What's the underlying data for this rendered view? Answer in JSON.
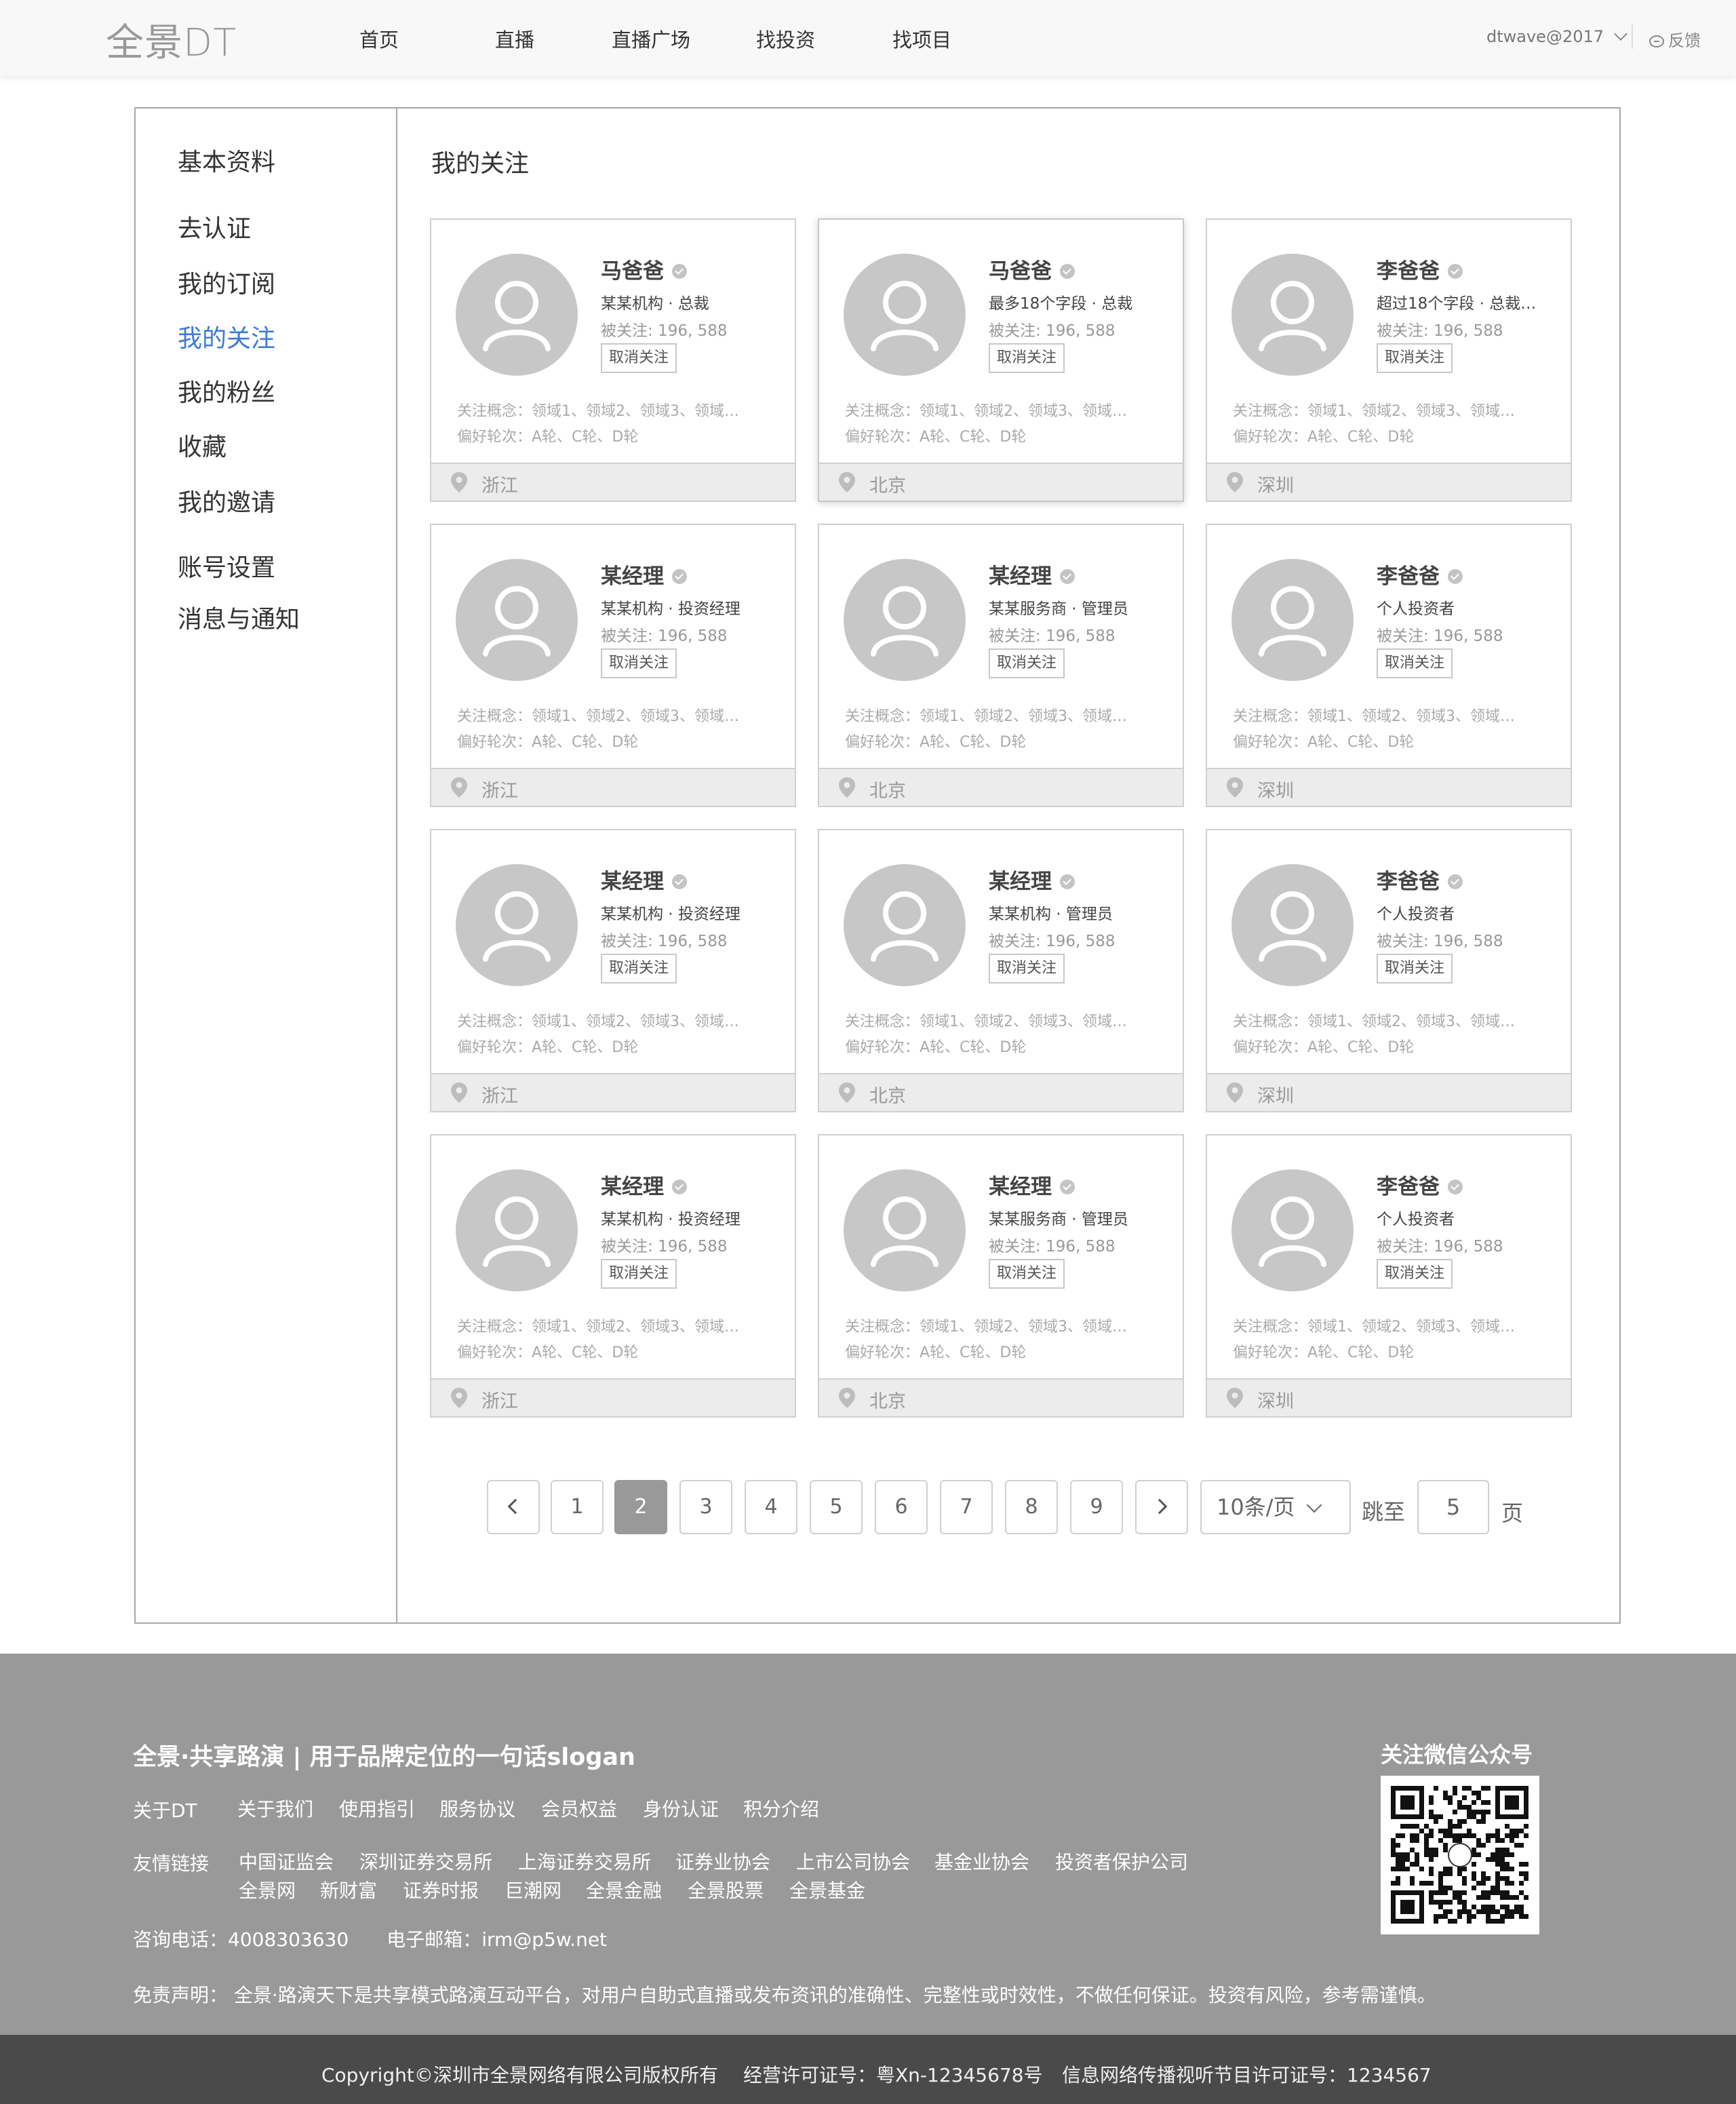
{
  "header": {
    "logo": "全景DT",
    "nav": [
      "首页",
      "直播",
      "直播广场",
      "找投资",
      "找项目"
    ],
    "user": "dtwave@2017",
    "feedback": "反馈"
  },
  "sidebar": {
    "items": [
      "基本资料",
      "去认证",
      "我的订阅",
      "我的关注",
      "我的粉丝",
      "收藏",
      "我的邀请",
      "账号设置",
      "消息与通知"
    ],
    "active": "我的关注"
  },
  "main": {
    "title": "我的关注",
    "cards": [
      {
        "name": "马爸爸",
        "org": "某某机构 · 总裁",
        "followers": "被关注: 196, 588",
        "button": "取消关注",
        "concepts": "关注概念：领域1、领域2、领域3、领域…",
        "rounds": "偏好轮次：A轮、C轮、D轮",
        "city": "浙江"
      },
      {
        "name": "马爸爸",
        "org": "最多18个字段 · 总裁",
        "followers": "被关注: 196, 588",
        "button": "取消关注",
        "concepts": "关注概念：领域1、领域2、领域3、领域…",
        "rounds": "偏好轮次：A轮、C轮、D轮",
        "city": "北京"
      },
      {
        "name": "李爸爸",
        "org": "超过18个字段 · 总裁…",
        "followers": "被关注: 196, 588",
        "button": "取消关注",
        "concepts": "关注概念：领域1、领域2、领域3、领域…",
        "rounds": "偏好轮次：A轮、C轮、D轮",
        "city": "深圳"
      },
      {
        "name": "某经理",
        "org": "某某机构 · 投资经理",
        "followers": "被关注: 196, 588",
        "button": "取消关注",
        "concepts": "关注概念：领域1、领域2、领域3、领域…",
        "rounds": "偏好轮次：A轮、C轮、D轮",
        "city": "浙江"
      },
      {
        "name": "某经理",
        "org": "某某服务商 · 管理员",
        "followers": "被关注: 196, 588",
        "button": "取消关注",
        "concepts": "关注概念：领域1、领域2、领域3、领域…",
        "rounds": "偏好轮次：A轮、C轮、D轮",
        "city": "北京"
      },
      {
        "name": "李爸爸",
        "org": "个人投资者",
        "followers": "被关注: 196, 588",
        "button": "取消关注",
        "concepts": "关注概念：领域1、领域2、领域3、领域…",
        "rounds": "偏好轮次：A轮、C轮、D轮",
        "city": "深圳"
      },
      {
        "name": "某经理",
        "org": "某某机构 · 投资经理",
        "followers": "被关注: 196, 588",
        "button": "取消关注",
        "concepts": "关注概念：领域1、领域2、领域3、领域…",
        "rounds": "偏好轮次：A轮、C轮、D轮",
        "city": "浙江"
      },
      {
        "name": "某经理",
        "org": "某某机构 · 管理员",
        "followers": "被关注: 196, 588",
        "button": "取消关注",
        "concepts": "关注概念：领域1、领域2、领域3、领域…",
        "rounds": "偏好轮次：A轮、C轮、D轮",
        "city": "北京"
      },
      {
        "name": "李爸爸",
        "org": "个人投资者",
        "followers": "被关注: 196, 588",
        "button": "取消关注",
        "concepts": "关注概念：领域1、领域2、领域3、领域…",
        "rounds": "偏好轮次：A轮、C轮、D轮",
        "city": "深圳"
      },
      {
        "name": "某经理",
        "org": "某某机构 · 投资经理",
        "followers": "被关注: 196, 588",
        "button": "取消关注",
        "concepts": "关注概念：领域1、领域2、领域3、领域…",
        "rounds": "偏好轮次：A轮、C轮、D轮",
        "city": "浙江"
      },
      {
        "name": "某经理",
        "org": "某某服务商 · 管理员",
        "followers": "被关注: 196, 588",
        "button": "取消关注",
        "concepts": "关注概念：领域1、领域2、领域3、领域…",
        "rounds": "偏好轮次：A轮、C轮、D轮",
        "city": "北京"
      },
      {
        "name": "李爸爸",
        "org": "个人投资者",
        "followers": "被关注: 196, 588",
        "button": "取消关注",
        "concepts": "关注概念：领域1、领域2、领域3、领域…",
        "rounds": "偏好轮次：A轮、C轮、D轮",
        "city": "深圳"
      }
    ]
  },
  "pagination": {
    "pages": [
      "1",
      "2",
      "3",
      "4",
      "5",
      "6",
      "7",
      "8",
      "9"
    ],
    "current": "2",
    "page_size": "10条/页",
    "jump_label": "跳至",
    "jump_value": "5",
    "page_suffix": "页"
  },
  "footer": {
    "slogan": "全景·共享路演 | 用于品牌定位的一句话slogan",
    "about_label": "关于DT",
    "about_links": [
      "关于我们",
      "使用指引",
      "服务协议",
      "会员权益",
      "身份认证",
      "积分介绍"
    ],
    "friends_label": "友情链接",
    "friend_links_row1": [
      "中国证监会",
      "深圳证券交易所",
      "上海证券交易所",
      "证券业协会",
      "上市公司协会",
      "基金业协会",
      "投资者保护公司"
    ],
    "friend_links_row2": [
      "全景网",
      "新财富",
      "证券时报",
      "巨潮网",
      "全景金融",
      "全景股票",
      "全景基金"
    ],
    "phone_label": "咨询电话：",
    "phone": "4008303630",
    "email_label": "电子邮箱：",
    "email": "irm@p5w.net",
    "disclaimer": "免责声明：  全景·路演天下是共享模式路演互动平台，对用户自助式直播或发布资讯的准确性、完整性或时效性，不做任何保证。投资有风险，参考需谨慎。",
    "qr_title": "关注微信公众号",
    "copyright": "Copyright©深圳市全景网络有限公司版权所有",
    "license": "经营许可证号：粤Xn-12345678号",
    "media_license": "信息网络传播视听节目许可证号：1234567"
  }
}
